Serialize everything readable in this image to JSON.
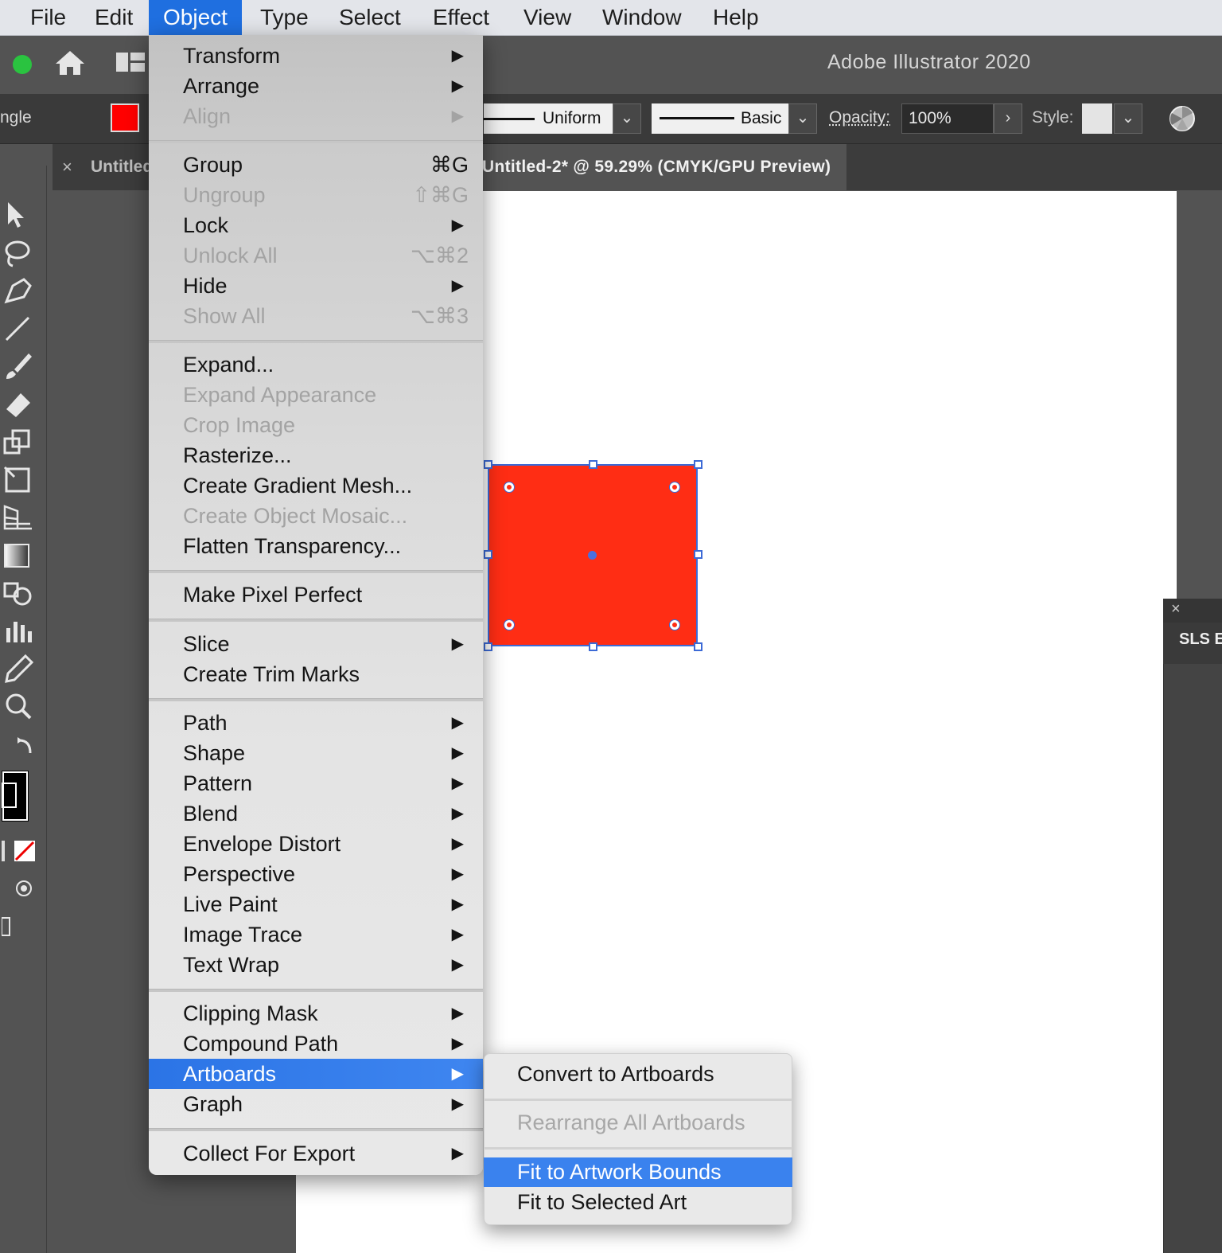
{
  "menubar": {
    "items": [
      "File",
      "Edit",
      "Object",
      "Type",
      "Select",
      "Effect",
      "View",
      "Window",
      "Help"
    ],
    "active": "Object"
  },
  "app": {
    "title": "Adobe Illustrator 2020",
    "icons": [
      "traffic-light-green",
      "home-icon",
      "workspace-layout-icon"
    ]
  },
  "control_bar": {
    "tool_name": "ngle",
    "fill_color": "#ff0000",
    "stroke_profile": "Uniform",
    "brush": "Basic",
    "opacity_label": "Opacity:",
    "opacity_value": "100%",
    "style_label": "Style:"
  },
  "tabs": [
    {
      "label": "Untitled",
      "close": "×"
    },
    {
      "label": "Untitled-2* @ 59.29% (CMYK/GPU Preview)"
    }
  ],
  "canvas": {
    "object_fill": "#ff2d14",
    "selection_color": "#3c6ad6"
  },
  "right_panel": {
    "close": "×",
    "title": "SLS E"
  },
  "object_menu": {
    "items": [
      {
        "label": "Transform",
        "arrow": "▶",
        "enabled": true
      },
      {
        "label": "Arrange",
        "arrow": "▶",
        "enabled": true
      },
      {
        "label": "Align",
        "arrow": "▶",
        "enabled": false
      },
      {
        "label": "Group",
        "shortcut": "⌘G",
        "enabled": true
      },
      {
        "label": "Ungroup",
        "shortcut": "⇧⌘G",
        "enabled": false
      },
      {
        "label": "Lock",
        "arrow": "▶",
        "enabled": true
      },
      {
        "label": "Unlock All",
        "shortcut": "⌥⌘2",
        "enabled": false
      },
      {
        "label": "Hide",
        "arrow": "▶",
        "enabled": true
      },
      {
        "label": "Show All",
        "shortcut": "⌥⌘3",
        "enabled": false
      },
      {
        "label": "Expand...",
        "enabled": true
      },
      {
        "label": "Expand Appearance",
        "enabled": false
      },
      {
        "label": "Crop Image",
        "enabled": false
      },
      {
        "label": "Rasterize...",
        "enabled": true
      },
      {
        "label": "Create Gradient Mesh...",
        "enabled": true
      },
      {
        "label": "Create Object Mosaic...",
        "enabled": false
      },
      {
        "label": "Flatten Transparency...",
        "enabled": true
      },
      {
        "label": "Make Pixel Perfect",
        "enabled": true
      },
      {
        "label": "Slice",
        "arrow": "▶",
        "enabled": true
      },
      {
        "label": "Create Trim Marks",
        "enabled": true
      },
      {
        "label": "Path",
        "arrow": "▶",
        "enabled": true
      },
      {
        "label": "Shape",
        "arrow": "▶",
        "enabled": true
      },
      {
        "label": "Pattern",
        "arrow": "▶",
        "enabled": true
      },
      {
        "label": "Blend",
        "arrow": "▶",
        "enabled": true
      },
      {
        "label": "Envelope Distort",
        "arrow": "▶",
        "enabled": true
      },
      {
        "label": "Perspective",
        "arrow": "▶",
        "enabled": true
      },
      {
        "label": "Live Paint",
        "arrow": "▶",
        "enabled": true
      },
      {
        "label": "Image Trace",
        "arrow": "▶",
        "enabled": true
      },
      {
        "label": "Text Wrap",
        "arrow": "▶",
        "enabled": true
      },
      {
        "label": "Clipping Mask",
        "arrow": "▶",
        "enabled": true
      },
      {
        "label": "Compound Path",
        "arrow": "▶",
        "enabled": true
      },
      {
        "label": "Artboards",
        "arrow": "▶",
        "enabled": true,
        "highlighted": true
      },
      {
        "label": "Graph",
        "arrow": "▶",
        "enabled": true
      },
      {
        "label": "Collect For Export",
        "arrow": "▶",
        "enabled": true
      }
    ]
  },
  "artboards_submenu": {
    "items": [
      {
        "label": "Convert to Artboards",
        "enabled": true
      },
      {
        "label": "Rearrange All Artboards",
        "enabled": false
      },
      {
        "label": "Fit to Artwork Bounds",
        "enabled": true,
        "highlighted": true
      },
      {
        "label": "Fit to Selected Art",
        "enabled": true
      }
    ]
  },
  "colors": {
    "menu_highlight": "#2b74e6",
    "app_bg": "#535353",
    "disabled_text": "#a3a3a3"
  }
}
